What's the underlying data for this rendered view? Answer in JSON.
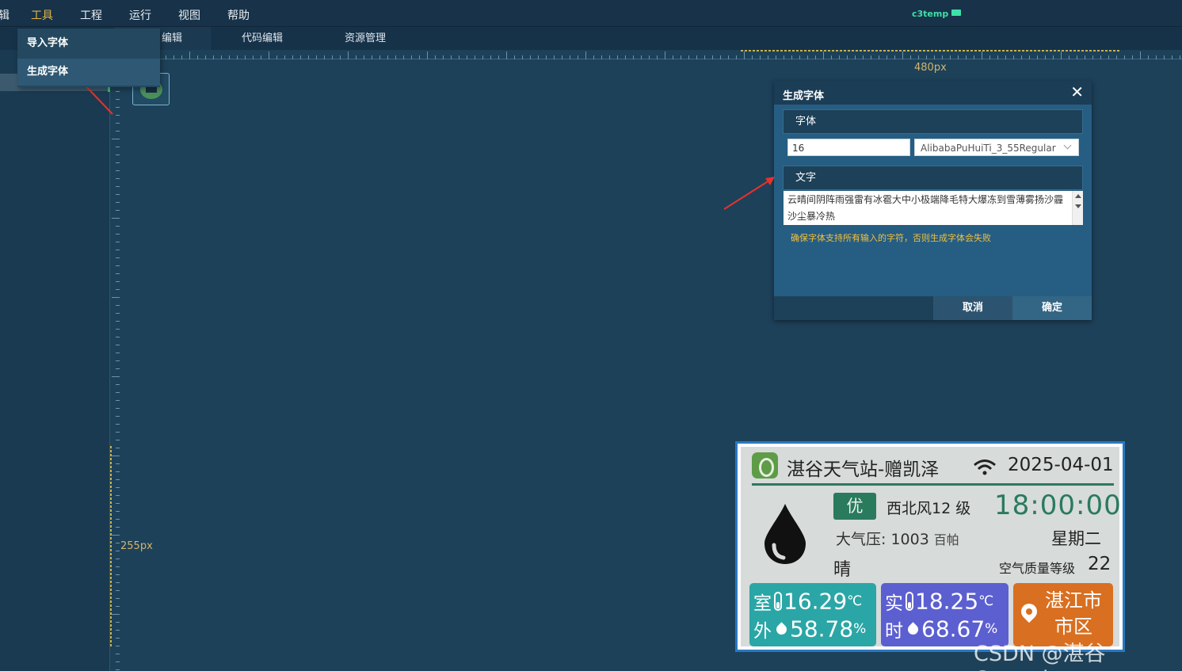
{
  "menu": {
    "items": [
      {
        "label": "辑",
        "x": "edit"
      },
      {
        "label": "工具"
      },
      {
        "label": "工程"
      },
      {
        "label": "运行"
      },
      {
        "label": "视图"
      },
      {
        "label": "帮助"
      }
    ],
    "project": "c3temp"
  },
  "tabs": [
    "编辑",
    "代码编辑",
    "资源管理"
  ],
  "dropdown": {
    "items": [
      "导入字体",
      "生成字体"
    ]
  },
  "rulers": {
    "h_label": "480px",
    "v_label": "255px"
  },
  "dialog": {
    "title": "生成字体",
    "close": "✕",
    "font_section": "字体",
    "font_size": "16",
    "font_name": "AlibabaPuHuiTi_3_55Regular",
    "text_section": "文字",
    "text_content": "云晴间阴阵雨强雷有冰雹大中小极端降毛特大爆冻到雪薄雾扬沙霾沙尘暴冷热",
    "warning": "确保字体支持所有输入的字符，否则生成字体会失败",
    "cancel": "取消",
    "ok": "确定"
  },
  "preview": {
    "title": "湛谷天气站-赠凯泽",
    "date": "2025-04-01",
    "aqi_badge": "优",
    "wind": "西北风12 级",
    "time": "18:00:00",
    "pressure_label": "大气压: 1003",
    "pressure_unit": "百帕",
    "weekday": "星期二",
    "condition": "晴",
    "aqi_label": "空气质量等级",
    "aqi_value": "22",
    "outdoor": {
      "l1": "室",
      "l2": "外",
      "temp": "16.29",
      "temp_unit": "℃",
      "hum": "58.78",
      "hum_unit": "%"
    },
    "realtime": {
      "l1": "实",
      "l2": "时",
      "temp": "18.25",
      "temp_unit": "℃",
      "hum": "68.67",
      "hum_unit": "%"
    },
    "location": "湛江市市区"
  },
  "watermark": "CSDN @湛谷Gooyuit",
  "colors": {
    "accent": "#e1b44a",
    "preview_green": "#2a7a5e",
    "arrow": "#e8322b"
  }
}
